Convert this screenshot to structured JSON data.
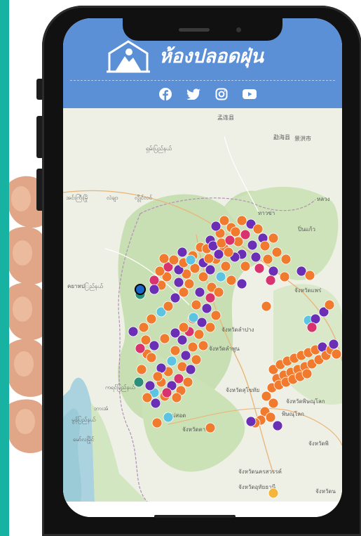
{
  "app": {
    "brand_name": "ห้องปลอดฝุ่น",
    "logo_icon": "house-mountain-logo-icon",
    "header_color": "#5b8fd6"
  },
  "social_links": [
    {
      "name": "facebook",
      "icon": "facebook-icon"
    },
    {
      "name": "twitter",
      "icon": "twitter-icon"
    },
    {
      "name": "instagram",
      "icon": "instagram-icon"
    },
    {
      "name": "youtube",
      "icon": "youtube-icon"
    }
  ],
  "map": {
    "labels": [
      {
        "text": "孟连县"
      },
      {
        "text": "勐海县"
      },
      {
        "text": "景洪市"
      },
      {
        "text": "ရှမ်းပြည်နယ်"
      },
      {
        "text": "အင်းကြီးမြို"
      },
      {
        "text": "လဲချာ"
      },
      {
        "text": "လွိုင်လင်"
      },
      {
        "text": "ทาวข่า"
      },
      {
        "text": "หลวง"
      },
      {
        "text": "ปิ่นแก้ว"
      },
      {
        "text": "คยาหปြည်နယ်"
      },
      {
        "text": "จังหวัดลำปาง"
      },
      {
        "text": "จังหวัดลำพูน"
      },
      {
        "text": "จังหวัดแพร่"
      },
      {
        "text": "จังหวัดสุโขทัย"
      },
      {
        "text": "จังหวัดพิษณุโลก"
      },
      {
        "text": "พิษณุโลก"
      },
      {
        "text": "แม่สอด"
      },
      {
        "text": "จังหวัดตาก"
      },
      {
        "text": "จังหวัดพิ"
      },
      {
        "text": "ကရင်ပြည်နယ်"
      },
      {
        "text": "မော်လမြိုင်"
      },
      {
        "text": "မွန်ပြည်နယ်"
      },
      {
        "text": "ဘားအံ"
      },
      {
        "text": "จังหวัดนครสวรรค์"
      },
      {
        "text": "จังหวัดอุทัยธานี"
      },
      {
        "text": "จังหวัดน"
      }
    ],
    "marker_colors": {
      "orange": "#f07a2e",
      "purple": "#6a2fb5",
      "pink": "#d8336e",
      "light_blue": "#5cc3e0",
      "teal": "#2b8f7a",
      "yellow": "#f5b53a"
    }
  }
}
